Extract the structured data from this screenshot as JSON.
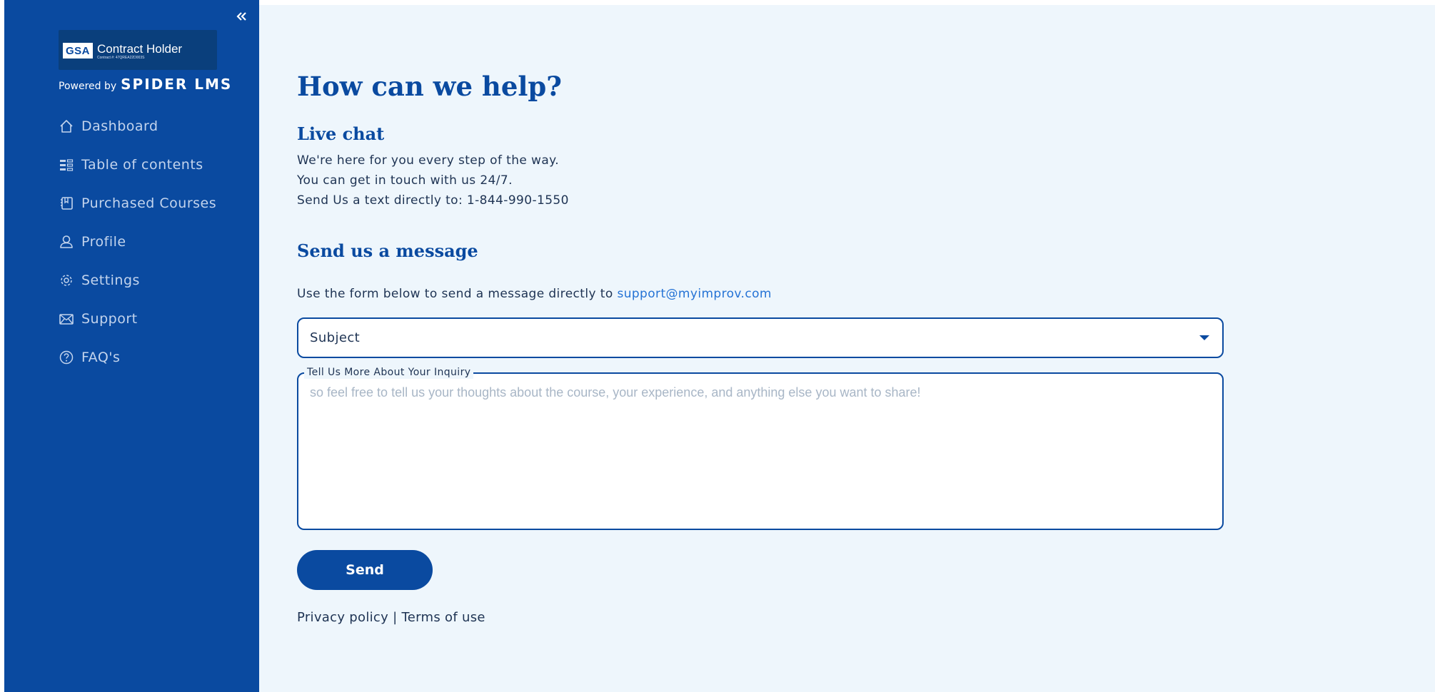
{
  "sidebar": {
    "badge": {
      "logo": "GSA",
      "title": "Contract Holder",
      "contract": "Contract #: 47QREA22D003S"
    },
    "powered_prefix": "Powered by",
    "powered_brand": "SPIDER LMS",
    "items": [
      {
        "label": "Dashboard",
        "icon": "home-icon"
      },
      {
        "label": "Table of contents",
        "icon": "list-icon"
      },
      {
        "label": "Purchased Courses",
        "icon": "book-icon"
      },
      {
        "label": "Profile",
        "icon": "user-icon"
      },
      {
        "label": "Settings",
        "icon": "gear-icon"
      },
      {
        "label": "Support",
        "icon": "mail-icon"
      },
      {
        "label": "FAQ's",
        "icon": "help-icon"
      }
    ]
  },
  "main": {
    "title": "How can we help?",
    "livechat": {
      "title": "Live chat",
      "lines": [
        "We're here for you every step of the way.",
        "You can get in touch with us 24/7.",
        "Send Us a text directly to: 1-844-990-1550"
      ]
    },
    "message": {
      "title": "Send us a message",
      "description": "Use the form below to send a message directly to",
      "email": "support@myimprov.com"
    },
    "form": {
      "subject_value": "Subject",
      "inquiry_label": "Tell Us More About Your Inquiry",
      "inquiry_placeholder": "so feel free to tell us your thoughts about the course, your experience, and anything else you want to share!",
      "send_label": "Send"
    },
    "footer": {
      "privacy": "Privacy policy",
      "separator": "|",
      "terms": "Terms of use"
    }
  },
  "colors": {
    "sidebar_bg": "#0a4aa0",
    "main_bg": "#eef6fc",
    "accent": "#0a4aa0",
    "link": "#2573d5",
    "text": "#1e3353"
  }
}
